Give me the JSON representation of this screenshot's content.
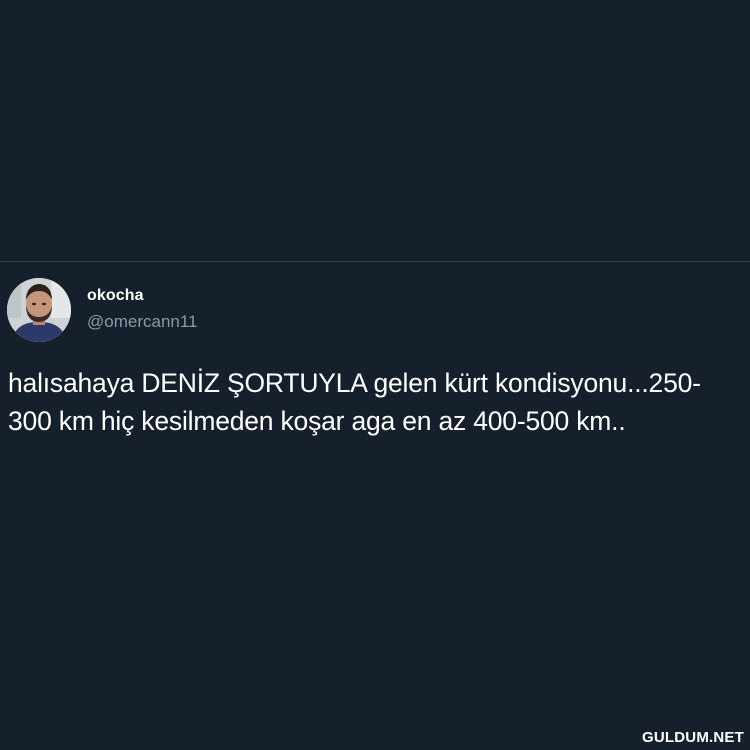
{
  "tweet": {
    "display_name": "okocha",
    "handle": "@omercann11",
    "text": "halısahaya DENİZ ŞORTUYLA gelen kürt kondisyonu...250-300 km hiç kesilmeden koşar aga en az 400-500 km.."
  },
  "watermark": "GULDUM.NET",
  "colors": {
    "background": "#16202c",
    "text": "#ffffff",
    "handle": "#8899a6"
  }
}
